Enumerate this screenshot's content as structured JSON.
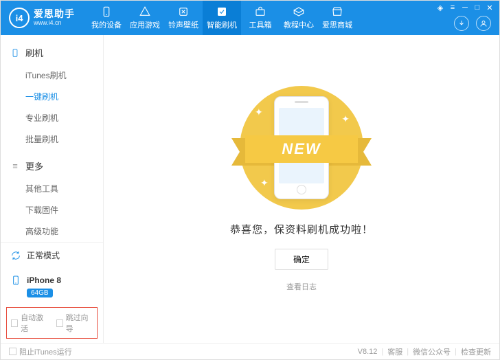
{
  "app": {
    "logo_char": "i4",
    "title": "爱思助手",
    "subtitle": "www.i4.cn"
  },
  "nav": [
    {
      "label": "我的设备"
    },
    {
      "label": "应用游戏"
    },
    {
      "label": "铃声壁纸"
    },
    {
      "label": "智能刷机"
    },
    {
      "label": "工具箱"
    },
    {
      "label": "教程中心"
    },
    {
      "label": "爱思商城"
    }
  ],
  "sidebar": {
    "cat1": {
      "title": "刷机",
      "items": [
        "iTunes刷机",
        "一键刷机",
        "专业刷机",
        "批量刷机"
      ],
      "active_index": 1
    },
    "cat2": {
      "title": "更多",
      "items": [
        "其他工具",
        "下载固件",
        "高级功能"
      ]
    },
    "mode": "正常模式",
    "device": {
      "name": "iPhone 8",
      "storage": "64GB"
    },
    "options": {
      "auto_activate": "自动激活",
      "skip_guide": "跳过向导"
    }
  },
  "main": {
    "ribbon": "NEW",
    "success": "恭喜您，保资料刷机成功啦！",
    "confirm": "确定",
    "view_log": "查看日志"
  },
  "footer": {
    "block_itunes": "阻止iTunes运行",
    "version": "V8.12",
    "support": "客服",
    "wechat": "微信公众号",
    "update": "检查更新"
  }
}
